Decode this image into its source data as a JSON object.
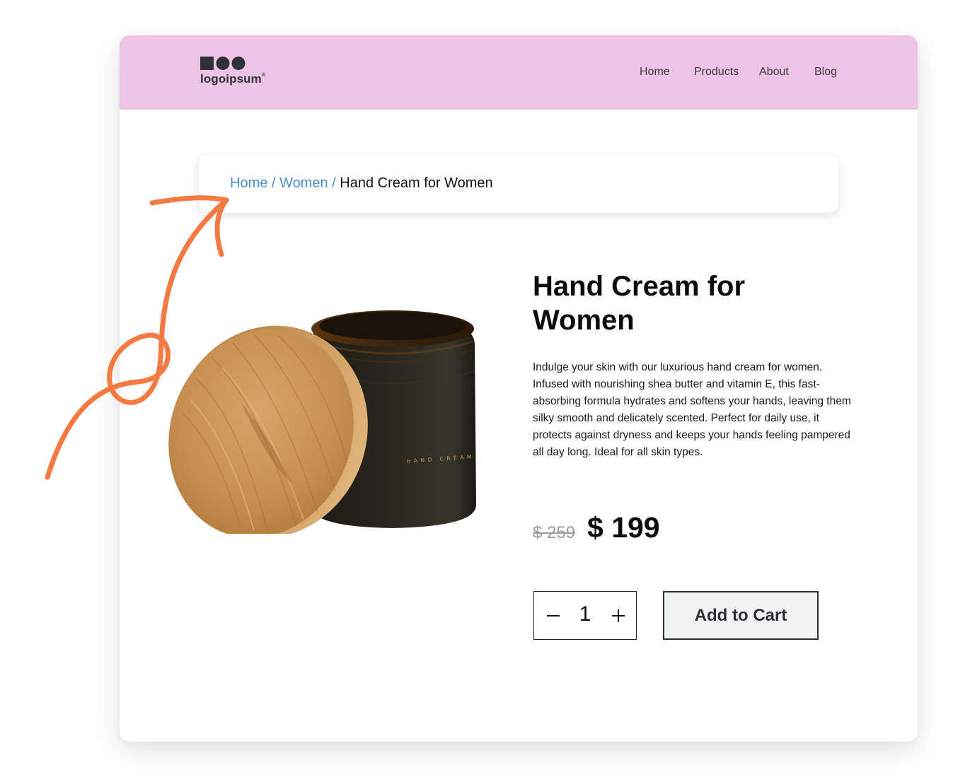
{
  "logo": {
    "text": "logoipsum",
    "mark": "®"
  },
  "nav": {
    "items": [
      {
        "label": "Home"
      },
      {
        "label": "Products"
      },
      {
        "label": "About"
      },
      {
        "label": "Blog"
      }
    ]
  },
  "breadcrumb": {
    "items": [
      {
        "label": "Home"
      },
      {
        "label": "Women"
      }
    ],
    "separator": "/",
    "current": "Hand Cream for Women"
  },
  "product": {
    "title": "Hand Cream for Women",
    "image_label": "HAND CREAM",
    "description": "Indulge your skin with our luxurious hand cream for women. Infused with nourishing shea butter and vitamin E, this fast-absorbing formula hydrates and softens your hands, leaving them silky smooth and delicately scented. Perfect for daily use, it protects against dryness and keeps your hands feeling pampered all day long. Ideal for all skin types.",
    "old_price": "$ 259",
    "price": "$ 199",
    "quantity": "1",
    "add_to_cart_label": "Add to Cart"
  },
  "colors": {
    "header_bg": "#edc3e6",
    "link": "#4d8fcb",
    "annotation_arrow": "#f47a41"
  }
}
